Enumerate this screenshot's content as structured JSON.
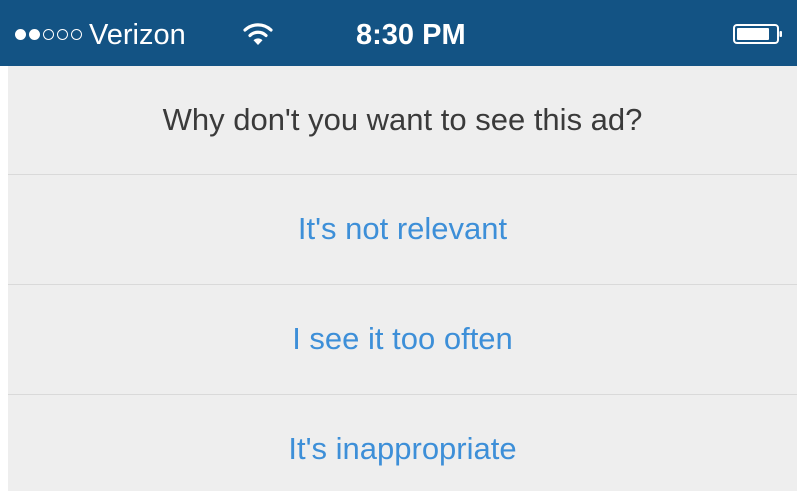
{
  "status_bar": {
    "signal_dots": [
      "full",
      "full",
      "empty",
      "empty",
      "empty"
    ],
    "carrier": "Verizon",
    "wifi_icon": "wifi-icon",
    "time": "8:30 PM",
    "battery_icon": "battery-icon",
    "background_color": "#135384"
  },
  "sheet": {
    "title": "Why don't you want to see this ad?",
    "options": [
      {
        "label": "It's not relevant"
      },
      {
        "label": "I see it too often"
      },
      {
        "label": "It's inappropriate"
      }
    ],
    "title_color": "#3a3a3a",
    "option_color": "#3d8fd8",
    "background_color": "#eeeeee"
  }
}
